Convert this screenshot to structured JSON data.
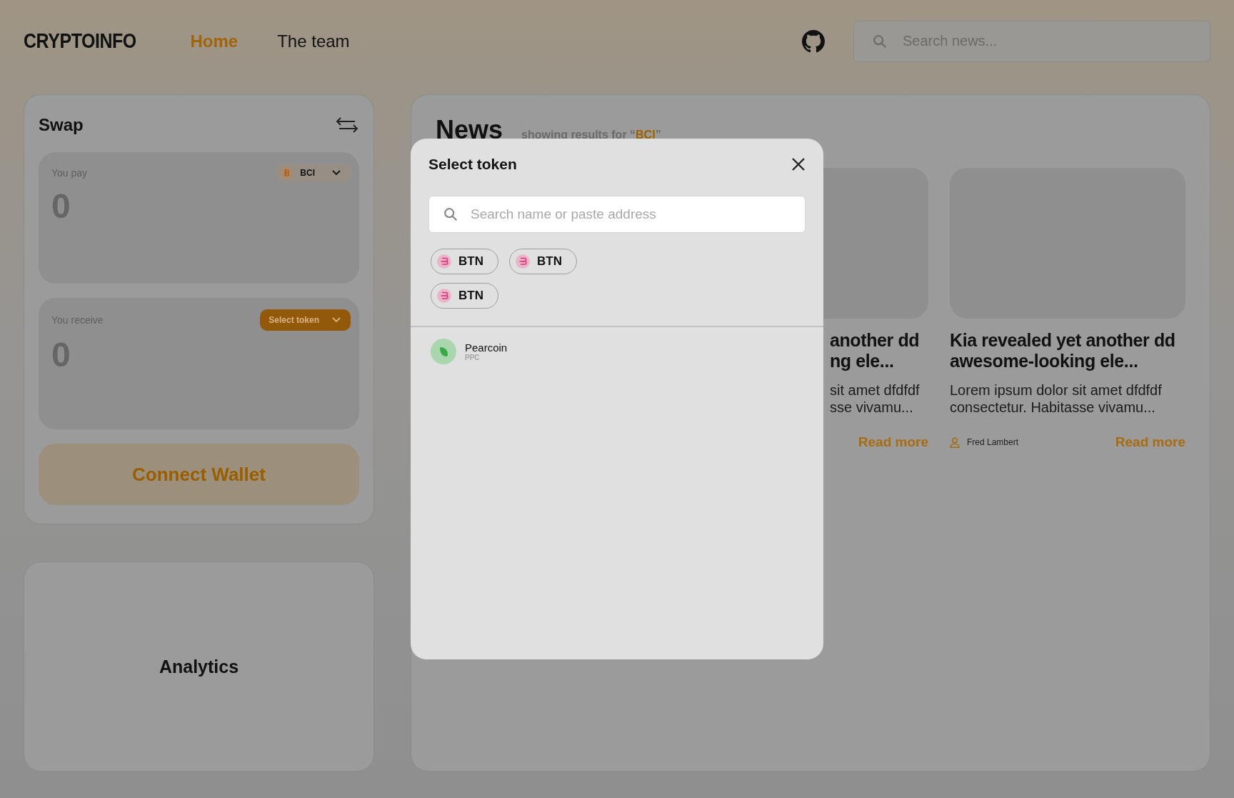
{
  "header": {
    "logo": "CRYPTOINFO",
    "nav": [
      {
        "label": "Home",
        "selected": true
      },
      {
        "label": "The team",
        "selected": false
      }
    ],
    "search": {
      "placeholder": "Search news..."
    }
  },
  "swap": {
    "title": "Swap",
    "pay": {
      "label": "You pay",
      "amount": "0",
      "token": "BCI"
    },
    "receive": {
      "label": "You receive",
      "amount": "0",
      "token_button": "Select token"
    },
    "connect_button": "Connect Wallet"
  },
  "analytics": {
    "title": "Analytics"
  },
  "news": {
    "title": "News",
    "subtitle_prefix": "showing results for “",
    "query": "BCI",
    "subtitle_suffix": "”",
    "cards": [
      {
        "kind": "partial",
        "title_lines": [
          "another dd",
          "ng ele..."
        ],
        "excerpt_lines": [
          "sit amet dfdfdf",
          "sse vivamu..."
        ],
        "read_more": "Read more"
      },
      {
        "kind": "full",
        "title": "Kia revealed yet another dd awesome-looking ele...",
        "excerpt": "Lorem ipsum dolor sit amet dfdfdf consectetur. Habitasse vivamu...",
        "author": "Fred Lambert",
        "read_more": "Read more"
      }
    ]
  },
  "modal": {
    "title": "Select token",
    "search": {
      "placeholder": "Search name or paste address"
    },
    "common_tokens": [
      {
        "symbol": "BTN"
      },
      {
        "symbol": "BTN"
      },
      {
        "symbol": "BTN"
      }
    ],
    "tokens": [
      {
        "name": "Pearcoin",
        "symbol": "PPC"
      }
    ]
  }
}
